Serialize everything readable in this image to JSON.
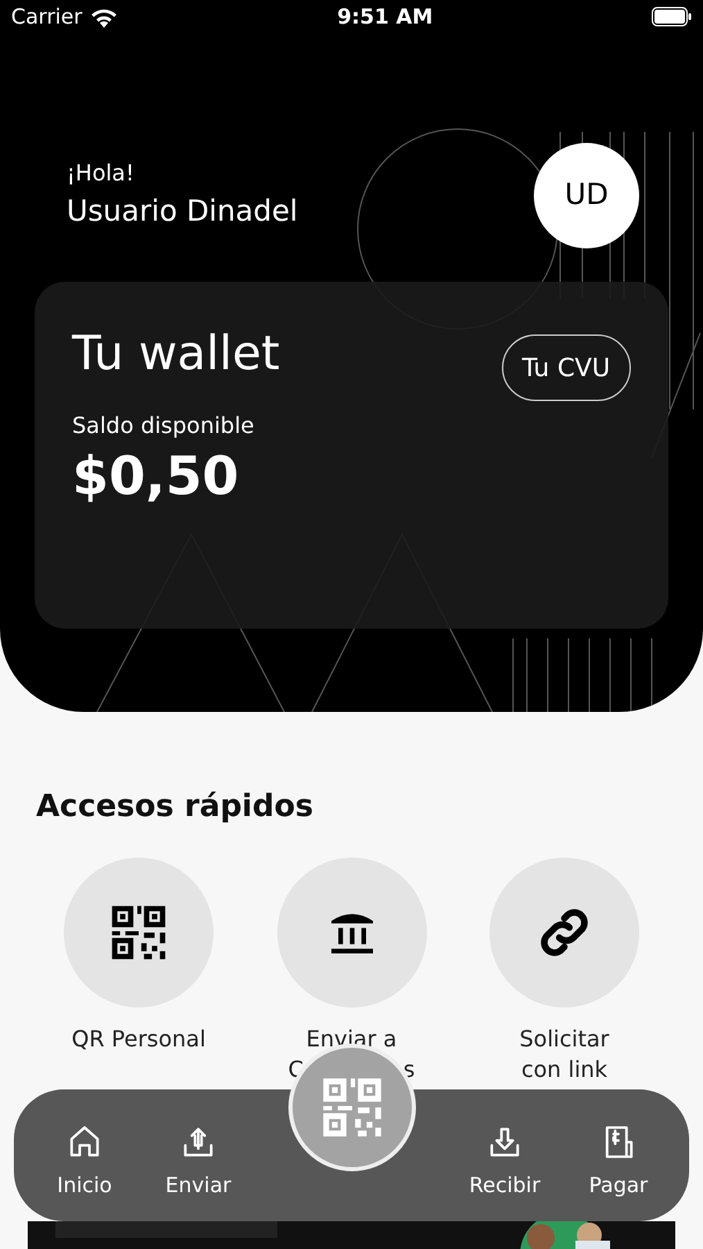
{
  "status_bar": {
    "carrier": "Carrier",
    "time": "9:51 AM"
  },
  "header": {
    "greeting": "¡Hola!",
    "user_name": "Usuario Dinadel",
    "avatar_initials": "UD"
  },
  "wallet_card": {
    "title": "Tu wallet",
    "cvu_button": "Tu CVU",
    "balance_label": "Saldo disponible",
    "balance": "$0,50"
  },
  "quick_access": {
    "title": "Accesos rápidos",
    "items": [
      {
        "kind": "qr",
        "lines": [
          [
            "QR Personal"
          ]
        ]
      },
      {
        "kind": "bank",
        "lines": [
          [
            "Enviar a"
          ],
          [
            "C",
            "s"
          ]
        ]
      },
      {
        "kind": "link",
        "lines": [
          [
            "Solicitar"
          ],
          [
            "con link"
          ]
        ]
      }
    ]
  },
  "bottom_nav": {
    "items": [
      {
        "kind": "home",
        "label": "Inicio"
      },
      {
        "kind": "send",
        "label": "Enviar"
      },
      {
        "kind": "receive",
        "label": "Recibir"
      },
      {
        "kind": "pay",
        "label": "Pagar"
      }
    ],
    "center_button": {
      "kind": "qr"
    }
  }
}
